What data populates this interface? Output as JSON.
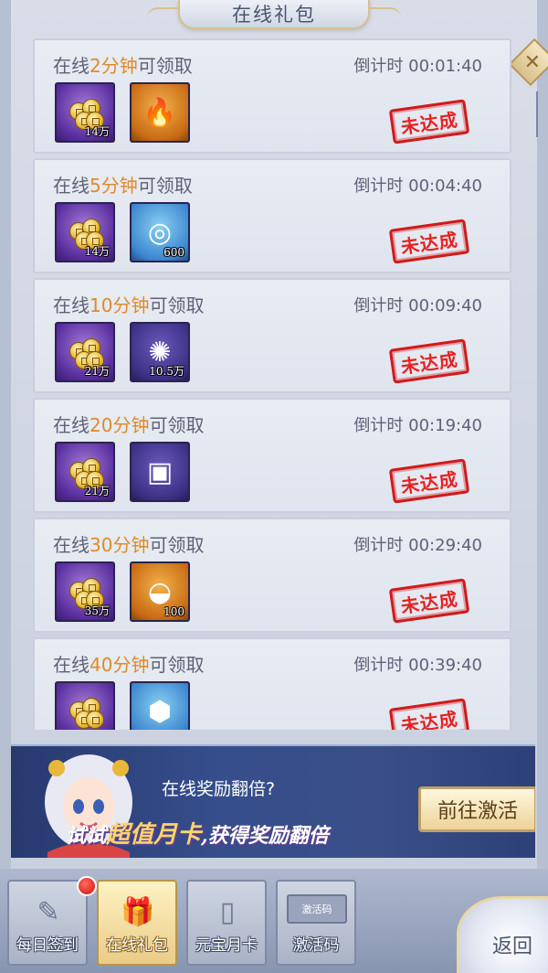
{
  "header": {
    "title": "在线礼包"
  },
  "rows": [
    {
      "prefix": "在线",
      "minutes": "2分钟",
      "suffix": "可领取",
      "countdown": "倒计时 00:01:40",
      "items": [
        {
          "kind": "coins",
          "qty": "14万"
        },
        {
          "kind": "orb",
          "qty": ""
        }
      ],
      "status": "未达成"
    },
    {
      "prefix": "在线",
      "minutes": "5分钟",
      "suffix": "可领取",
      "countdown": "倒计时 00:04:40",
      "items": [
        {
          "kind": "coins",
          "qty": "14万"
        },
        {
          "kind": "stone",
          "qty": "600"
        }
      ],
      "status": "未达成"
    },
    {
      "prefix": "在线",
      "minutes": "10分钟",
      "suffix": "可领取",
      "countdown": "倒计时 00:09:40",
      "items": [
        {
          "kind": "coins",
          "qty": "21万"
        },
        {
          "kind": "swirl",
          "qty": "10.5万"
        }
      ],
      "status": "未达成"
    },
    {
      "prefix": "在线",
      "minutes": "20分钟",
      "suffix": "可领取",
      "countdown": "倒计时 00:19:40",
      "items": [
        {
          "kind": "coins",
          "qty": "21万"
        },
        {
          "kind": "chest",
          "qty": ""
        }
      ],
      "status": "未达成"
    },
    {
      "prefix": "在线",
      "minutes": "30分钟",
      "suffix": "可领取",
      "countdown": "倒计时 00:29:40",
      "items": [
        {
          "kind": "coins",
          "qty": "35万"
        },
        {
          "kind": "ingot",
          "qty": "100"
        }
      ],
      "status": "未达成"
    },
    {
      "prefix": "在线",
      "minutes": "40分钟",
      "suffix": "可领取",
      "countdown": "倒计时 00:39:40",
      "items": [
        {
          "kind": "coins",
          "qty": ""
        },
        {
          "kind": "hexswirl",
          "qty": ""
        }
      ],
      "status": "未达成"
    }
  ],
  "banner": {
    "question": "在线奖励翻倍?",
    "slogan_pre": "试试",
    "slogan_highlight": "超值月卡",
    "slogan_post": ",获得奖励翻倍",
    "button": "前往激活"
  },
  "tabs": [
    {
      "label": "每日签到",
      "active": false,
      "badge": true
    },
    {
      "label": "在线礼包",
      "active": true,
      "badge": false
    },
    {
      "label": "元宝月卡",
      "active": false,
      "badge": false
    },
    {
      "label": "激活码",
      "active": false,
      "badge": false,
      "icon_text": "激活码"
    }
  ],
  "back": {
    "label": "返回"
  },
  "icons": {
    "close": "close-icon",
    "coins": "coins-icon",
    "orb": "fire-orb-icon",
    "stone": "spirit-stone-icon",
    "swirl": "swirl-gem-icon",
    "chest": "treasure-chest-icon",
    "ingot": "gold-ingot-icon",
    "hexswirl": "hex-swirl-icon"
  },
  "colors": {
    "highlight": "#e08a2a",
    "stamp": "#e52222",
    "text": "#5d6277"
  }
}
